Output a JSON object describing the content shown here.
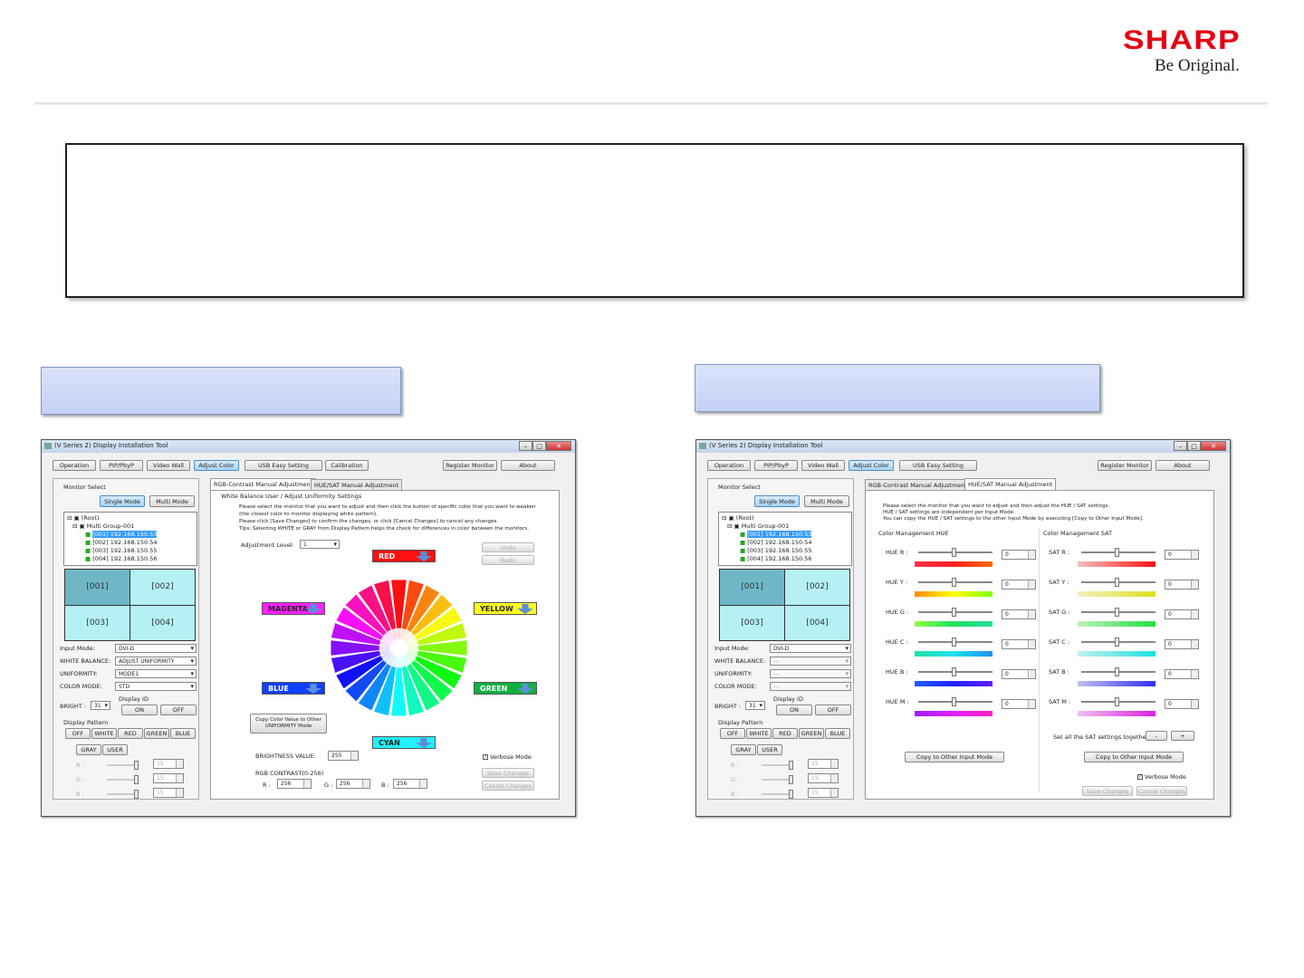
{
  "brand": {
    "name": "SHARP",
    "tagline": "Be Original."
  },
  "left_window": {
    "title": "(V Series 2) Display Installation Tool",
    "toolbar": [
      "Operation",
      "PIP/PbyP",
      "Video Wall",
      "Adjust Color",
      "USB Easy Setting",
      "Calibration"
    ],
    "toolbar_right": [
      "Register Monitor",
      "About"
    ],
    "monitor_select": "Monitor Select",
    "single_mode": "Single Mode",
    "multi_mode": "Multi Mode",
    "tree": [
      "(Root)",
      "Multi Group-001",
      "[001] 192.168.150.53",
      "[002] 192.168.150.54",
      "[003] 192.168.150.55",
      "[004] 192.168.150.56"
    ],
    "grid": [
      "[001]",
      "[002]",
      "[003]",
      "[004]"
    ],
    "fields": [
      {
        "label": "Input Mode:",
        "value": "DVI-D"
      },
      {
        "label": "WHITE BALANCE:",
        "value": "ADJUST UNIFORMITY"
      },
      {
        "label": "UNIFORMITY:",
        "value": "MODE1"
      },
      {
        "label": "COLOR MODE:",
        "value": "STD"
      }
    ],
    "bright_label": "BRIGHT :",
    "bright_value": "31",
    "display_id": "Display ID",
    "on": "ON",
    "off": "OFF",
    "display_pattern": "Display Pattern",
    "patterns": [
      "OFF",
      "WHITE",
      "RED",
      "GREEN",
      "BLUE"
    ],
    "patterns2": [
      "GRAY",
      "USER"
    ],
    "rgb_rows": [
      {
        "label": "R :",
        "value": "15"
      },
      {
        "label": "G :",
        "value": "15"
      },
      {
        "label": "B :",
        "value": "15"
      }
    ],
    "tabs": [
      "RGB-Contrast Manual Adjustment",
      "HUE/SAT Manual Adjustment"
    ],
    "section_title": "White Balance User / Adjust Uniformity Settings",
    "instructions": [
      "Please select the monitor that you want to adjust and then click the button of specific color that you want to weaken",
      "(the closest color to monitor displaying white pattern).",
      "Please click [Save Changes] to confirm the changes, or click [Cancel Changes] to cancel any changes.",
      "Tips: Selecting WHITE or GRAY from Display Pattern helps the check for differences in color between the monitors."
    ],
    "adjustment_level": "Adjustment Level:",
    "adjustment_value": "1",
    "undo": "Undo",
    "redo": "Redo",
    "colors": [
      {
        "name": "RED",
        "bg": "#ff1010"
      },
      {
        "name": "MAGENTA",
        "bg": "#ff20ff"
      },
      {
        "name": "YELLOW",
        "bg": "#ffff20"
      },
      {
        "name": "BLUE",
        "bg": "#1040ff"
      },
      {
        "name": "GREEN",
        "bg": "#10b040"
      },
      {
        "name": "CYAN",
        "bg": "#20f0ff"
      }
    ],
    "copy_button": "Copy Color Value to Other UNIFORMITY Mode",
    "brightness_label": "BRIGHTNESS VALUE:",
    "brightness_value": "255",
    "rgb_contrast_label": "RGB CONTRAST(0-256)",
    "rgb_contrast": [
      {
        "label": "R :",
        "value": "256"
      },
      {
        "label": "G :",
        "value": "256"
      },
      {
        "label": "B :",
        "value": "256"
      }
    ],
    "verbose": "Verbose Mode",
    "save": "Save Changes",
    "cancel": "Cancel Changes"
  },
  "right_window": {
    "title": "(V Series 2) Display Installation Tool",
    "toolbar": [
      "Operation",
      "PIP/PbyP",
      "Video Wall",
      "Adjust Color",
      "USB Easy Setting"
    ],
    "toolbar_right": [
      "Register Monitor",
      "About"
    ],
    "fields": [
      {
        "label": "Input Mode:",
        "value": "DVI-D"
      },
      {
        "label": "WHITE BALANCE:",
        "value": "---"
      },
      {
        "label": "UNIFORMITY:",
        "value": "---"
      },
      {
        "label": "COLOR MODE:",
        "value": "---"
      }
    ],
    "instructions": [
      "Please select the monitor that you want to adjust and then adjust the HUE / SAT settings.",
      "HUE / SAT settings are independent per Input Mode.",
      "You can copy the HUE / SAT settings to the other Input Mode by executing [Copy to Other Input Mode]."
    ],
    "hue_title": "Color Management HUE",
    "sat_title": "Color Management SAT",
    "hue_rows": [
      {
        "label": "HUE R :",
        "value": "0",
        "grad": "linear-gradient(90deg,#ff3050,#ff2020,#ff6a00)"
      },
      {
        "label": "HUE Y :",
        "value": "0",
        "grad": "linear-gradient(90deg,#ff8a00,#ffff00,#80ff00)"
      },
      {
        "label": "HUE G :",
        "value": "0",
        "grad": "linear-gradient(90deg,#90ff40,#20e060,#20e0a0)"
      },
      {
        "label": "HUE C :",
        "value": "0",
        "grad": "linear-gradient(90deg,#20e0a0,#20e0f0,#2090f0)"
      },
      {
        "label": "HUE B :",
        "value": "0",
        "grad": "linear-gradient(90deg,#2060ff,#2020ff,#6020ff)"
      },
      {
        "label": "HUE M :",
        "value": "0",
        "grad": "linear-gradient(90deg,#a020ff,#e020ff,#ff20c0)"
      }
    ],
    "sat_rows": [
      {
        "label": "SAT R :",
        "value": "0",
        "grad": "linear-gradient(90deg,#f0c0c0,#ff1010)"
      },
      {
        "label": "SAT Y :",
        "value": "0",
        "grad": "linear-gradient(90deg,#f0f0c0,#e0e020)"
      },
      {
        "label": "SAT G :",
        "value": "0",
        "grad": "linear-gradient(90deg,#c0f0c0,#20e040)"
      },
      {
        "label": "SAT C :",
        "value": "0",
        "grad": "linear-gradient(90deg,#c0f0f0,#20e0e0)"
      },
      {
        "label": "SAT B :",
        "value": "0",
        "grad": "linear-gradient(90deg,#c0c0f0,#3030f0)"
      },
      {
        "label": "SAT M :",
        "value": "0",
        "grad": "linear-gradient(90deg,#f0c0f0,#e020e0)"
      }
    ],
    "set_all": "Set all the SAT settings together :",
    "minus": "-",
    "plus": "+",
    "copy_input": "Copy to Other Input Mode"
  }
}
